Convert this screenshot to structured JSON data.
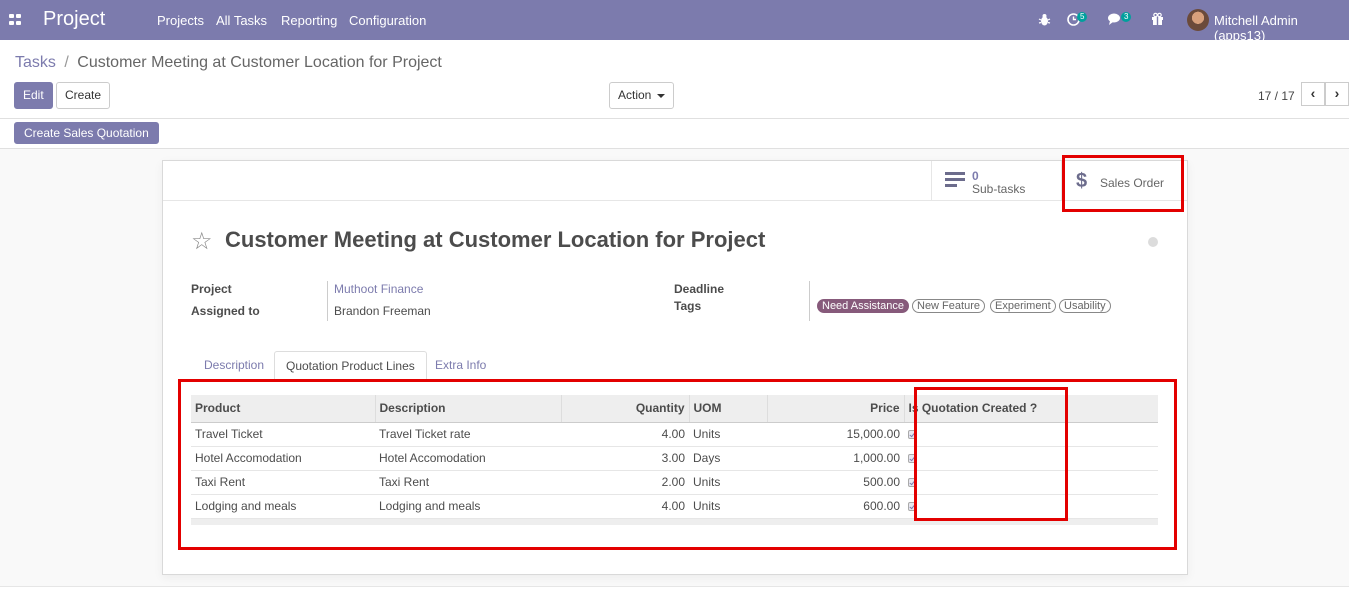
{
  "navbar": {
    "app_name": "Project",
    "menu": [
      "Projects",
      "All Tasks",
      "Reporting",
      "Configuration"
    ],
    "activity_count": "5",
    "message_count": "3",
    "user": "Mitchell Admin (apps13)"
  },
  "control_panel": {
    "breadcrumb_parent": "Tasks",
    "breadcrumb_separator": "/",
    "breadcrumb_current": "Customer Meeting at Customer Location for Project",
    "edit_label": "Edit",
    "create_label": "Create",
    "action_label": "Action",
    "pager": "17 / 17",
    "prev_icon": "‹",
    "next_icon": "›"
  },
  "statusbar": {
    "create_sales_quotation": "Create Sales Quotation"
  },
  "button_box": {
    "subtasks_value": "0",
    "subtasks_label": "Sub-tasks",
    "sales_order_label": "Sales Order"
  },
  "record": {
    "title": "Customer Meeting at Customer Location for Project",
    "project_label": "Project",
    "project_value": "Muthoot Finance",
    "assigned_label": "Assigned to",
    "assigned_value": "Brandon Freeman",
    "deadline_label": "Deadline",
    "tags_label": "Tags",
    "tags": [
      "Need Assistance",
      "New Feature",
      "Experiment",
      "Usability"
    ]
  },
  "tabs": [
    "Description",
    "Quotation Product Lines",
    "Extra Info"
  ],
  "table": {
    "columns": [
      "Product",
      "Description",
      "Quantity",
      "UOM",
      "Price",
      "Is Quotation Created ?"
    ],
    "rows": [
      {
        "product": "Travel Ticket",
        "description": "Travel Ticket rate",
        "quantity": "4.00",
        "uom": "Units",
        "price": "15,000.00",
        "created": true
      },
      {
        "product": "Hotel Accomodation",
        "description": "Hotel Accomodation",
        "quantity": "3.00",
        "uom": "Days",
        "price": "1,000.00",
        "created": true
      },
      {
        "product": "Taxi Rent",
        "description": "Taxi Rent",
        "quantity": "2.00",
        "uom": "Units",
        "price": "500.00",
        "created": true
      },
      {
        "product": "Lodging and meals",
        "description": "Lodging and meals",
        "quantity": "4.00",
        "uom": "Units",
        "price": "600.00",
        "created": true
      }
    ]
  },
  "colors": {
    "brand": "#7c7bad",
    "tag": "#875a7b",
    "highlight": "#e30000"
  }
}
